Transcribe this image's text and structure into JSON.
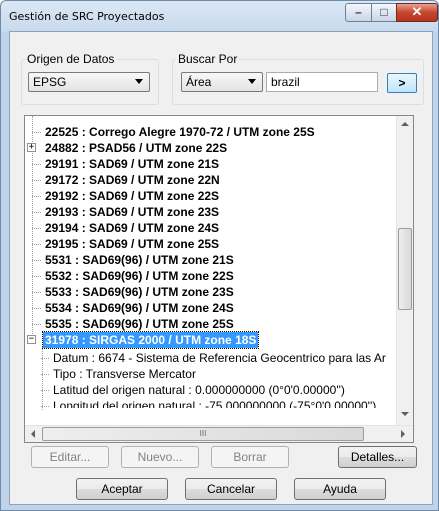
{
  "window": {
    "title": "Gestión de SRC Proyectados",
    "min_glyph": "–",
    "max_glyph": "□",
    "close_glyph": "✕"
  },
  "origen": {
    "label": "Origen de Datos",
    "value": "EPSG"
  },
  "buscar": {
    "label": "Buscar Por",
    "field": "Área",
    "query": "brazil",
    "go_glyph": ">"
  },
  "tree": {
    "items": [
      {
        "text": "22525 : Corrego Alegre 1970-72 / UTM zone 25S",
        "expander": ""
      },
      {
        "text": "24882 : PSAD56 / UTM zone 22S",
        "expander": "+"
      },
      {
        "text": "29191 : SAD69 / UTM zone 21S",
        "expander": ""
      },
      {
        "text": "29172 : SAD69 / UTM zone 22N",
        "expander": ""
      },
      {
        "text": "29192 : SAD69 / UTM zone 22S",
        "expander": ""
      },
      {
        "text": "29193 : SAD69 / UTM zone 23S",
        "expander": ""
      },
      {
        "text": "29194 : SAD69 / UTM zone 24S",
        "expander": ""
      },
      {
        "text": "29195 : SAD69 / UTM zone 25S",
        "expander": ""
      },
      {
        "text": "5531 : SAD69(96) / UTM zone 21S",
        "expander": ""
      },
      {
        "text": "5532 : SAD69(96) / UTM zone 22S",
        "expander": ""
      },
      {
        "text": "5533 : SAD69(96) / UTM zone 23S",
        "expander": ""
      },
      {
        "text": "5534 : SAD69(96) / UTM zone 24S",
        "expander": ""
      },
      {
        "text": "5535 : SAD69(96) / UTM zone 25S",
        "expander": ""
      },
      {
        "text": "31978 : SIRGAS 2000 / UTM zone 18S",
        "expander": "−",
        "selected": true
      }
    ],
    "children": [
      {
        "text": "Datum : 6674 - Sistema de Referencia Geocentrico para las Ar"
      },
      {
        "text": "Tipo : Transverse Mercator"
      },
      {
        "text": "Latitud del origen natural : 0.000000000 (0°0'0.00000'')"
      },
      {
        "text": "Longitud del origen natural : -75.000000000 (-75°0'0.00000'')"
      }
    ],
    "hscroll_grip": "III"
  },
  "actions": {
    "edit": "Editar...",
    "new": "Nuevo...",
    "delete": "Borrar",
    "details": "Detalles...",
    "accept": "Aceptar",
    "cancel": "Cancelar",
    "help": "Ayuda"
  }
}
